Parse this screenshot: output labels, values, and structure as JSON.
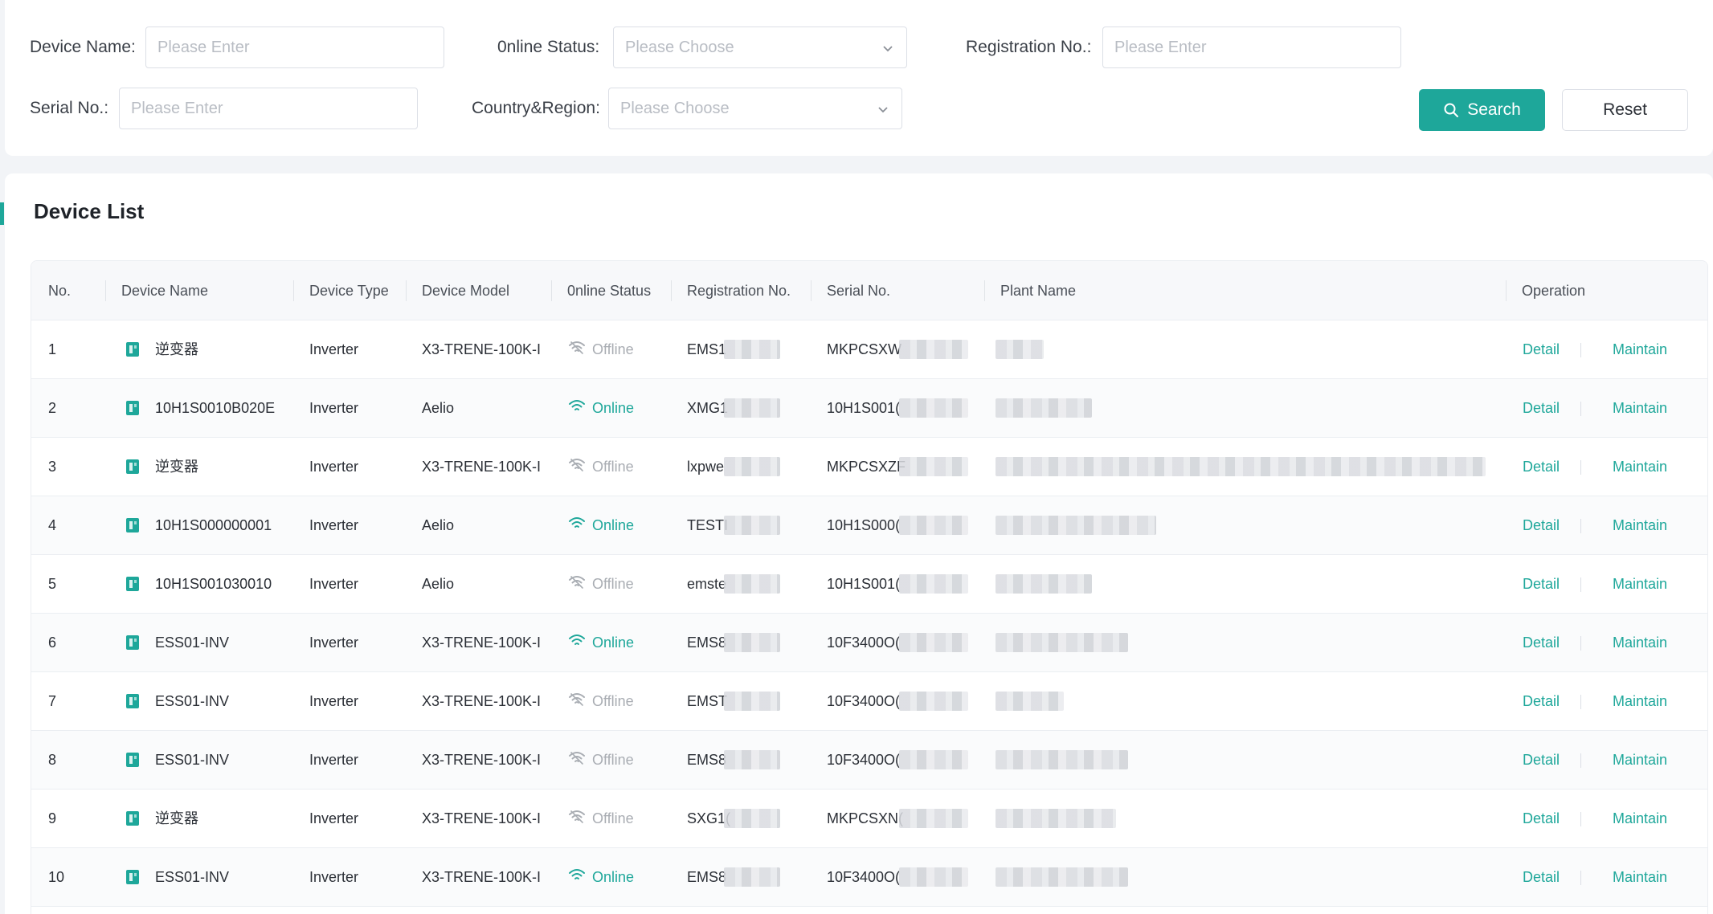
{
  "filters": {
    "device_name": {
      "label": "Device Name:",
      "placeholder": "Please Enter"
    },
    "online_status": {
      "label": "0nline Status:",
      "placeholder": "Please Choose"
    },
    "registration_no": {
      "label": "Registration No.:",
      "placeholder": "Please Enter"
    },
    "serial_no": {
      "label": "Serial No.:",
      "placeholder": "Please Enter"
    },
    "country_region": {
      "label": "Country&Region:",
      "placeholder": "Please Choose"
    },
    "search_label": "Search",
    "reset_label": "Reset"
  },
  "list": {
    "title": "Device List",
    "columns": [
      "No.",
      "Device Name",
      "Device Type",
      "Device Model",
      "0nline Status",
      "Registration No.",
      "Serial No.",
      "Plant Name",
      "Operation"
    ],
    "rows": [
      {
        "no": "1",
        "name": "逆变器",
        "type": "Inverter",
        "model": "X3-TRENE-100K-I",
        "status": "Offline",
        "reg": "EMS1",
        "serial": "MKPCSXW",
        "detail": "Detail",
        "maintain": "Maintain"
      },
      {
        "no": "2",
        "name": "10H1S0010B020E",
        "type": "Inverter",
        "model": "Aelio",
        "status": "Online",
        "reg": "XMG1",
        "serial": "10H1S001(",
        "detail": "Detail",
        "maintain": "Maintain"
      },
      {
        "no": "3",
        "name": "逆变器",
        "type": "Inverter",
        "model": "X3-TRENE-100K-I",
        "status": "Offline",
        "reg": "lxpwe",
        "serial": "MKPCSXZF",
        "detail": "Detail",
        "maintain": "Maintain"
      },
      {
        "no": "4",
        "name": "10H1S000000001",
        "type": "Inverter",
        "model": "Aelio",
        "status": "Online",
        "reg": "TESTI",
        "serial": "10H1S000(",
        "detail": "Detail",
        "maintain": "Maintain"
      },
      {
        "no": "5",
        "name": "10H1S001030010",
        "type": "Inverter",
        "model": "Aelio",
        "status": "Offline",
        "reg": "emste",
        "serial": "10H1S001(",
        "detail": "Detail",
        "maintain": "Maintain"
      },
      {
        "no": "6",
        "name": "ESS01-INV",
        "type": "Inverter",
        "model": "X3-TRENE-100K-I",
        "status": "Online",
        "reg": "EMS8",
        "serial": "10F3400O(",
        "detail": "Detail",
        "maintain": "Maintain"
      },
      {
        "no": "7",
        "name": "ESS01-INV",
        "type": "Inverter",
        "model": "X3-TRENE-100K-I",
        "status": "Offline",
        "reg": "EMST",
        "serial": "10F3400O(",
        "detail": "Detail",
        "maintain": "Maintain"
      },
      {
        "no": "8",
        "name": "ESS01-INV",
        "type": "Inverter",
        "model": "X3-TRENE-100K-I",
        "status": "Offline",
        "reg": "EMS8",
        "serial": "10F3400O(",
        "detail": "Detail",
        "maintain": "Maintain"
      },
      {
        "no": "9",
        "name": "逆变器",
        "type": "Inverter",
        "model": "X3-TRENE-100K-I",
        "status": "Offline",
        "reg": "SXG1(",
        "serial": "MKPCSXN(",
        "detail": "Detail",
        "maintain": "Maintain"
      },
      {
        "no": "10",
        "name": "ESS01-INV",
        "type": "Inverter",
        "model": "X3-TRENE-100K-I",
        "status": "Online",
        "reg": "EMS8",
        "serial": "10F3400O(",
        "detail": "Detail",
        "maintain": "Maintain"
      }
    ]
  },
  "colors": {
    "accent": "#1ea79a",
    "offline": "#a9adb3"
  },
  "icons": {
    "search": "search-icon",
    "chevron": "chevron-down-icon",
    "device": "device-icon",
    "wifi": "wifi-icon"
  }
}
